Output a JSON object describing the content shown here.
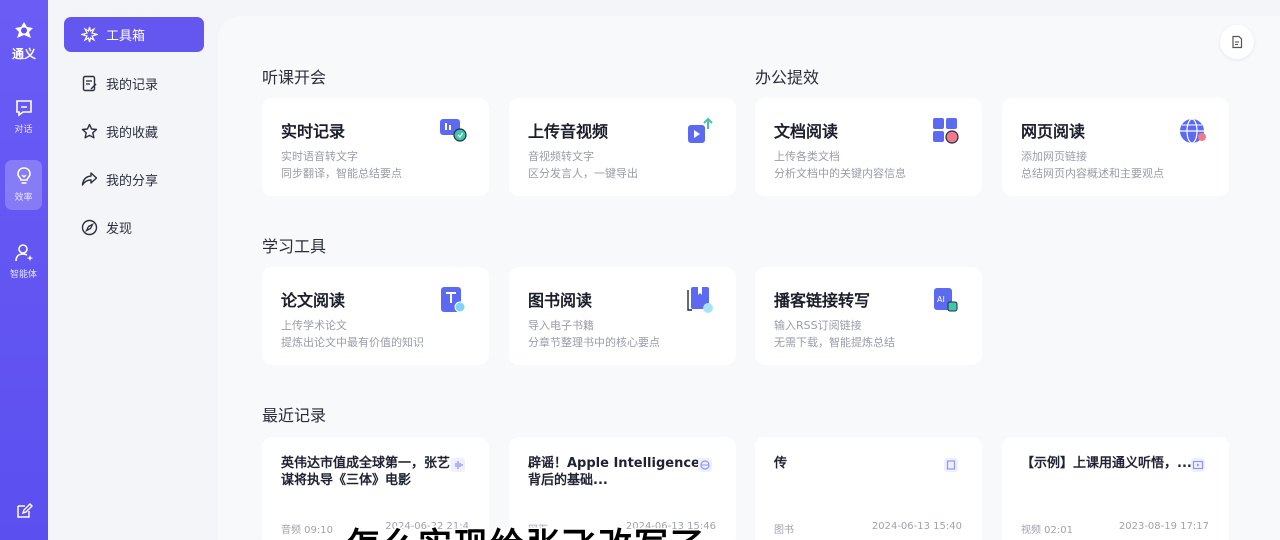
{
  "rail": {
    "logo_text": "通义",
    "items": [
      {
        "label": "对话",
        "icon": "chat-icon"
      },
      {
        "label": "效率",
        "icon": "lightbulb-icon",
        "active": true
      },
      {
        "label": "智能体",
        "icon": "agent-icon"
      }
    ],
    "bottom_icon": "edit-icon"
  },
  "subnav": {
    "items": [
      {
        "label": "工具箱",
        "icon": "toolbox-icon",
        "active": true
      },
      {
        "label": "我的记录",
        "icon": "record-icon"
      },
      {
        "label": "我的收藏",
        "icon": "star-icon"
      },
      {
        "label": "我的分享",
        "icon": "share-icon"
      },
      {
        "label": "发现",
        "icon": "compass-icon"
      }
    ]
  },
  "sections": {
    "listen": "听课开会",
    "office": "办公提效",
    "study": "学习工具",
    "recent": "最近记录"
  },
  "tools": [
    {
      "title": "实时记录",
      "desc1": "实时语音转文字",
      "desc2": "同步翻译，智能总结要点",
      "icon": "realtime-record-icon"
    },
    {
      "title": "上传音视频",
      "desc1": "音视频转文字",
      "desc2": "区分发言人，一键导出",
      "icon": "upload-media-icon"
    },
    {
      "title": "文档阅读",
      "desc1": "上传各类文档",
      "desc2": "分析文档中的关键内容信息",
      "icon": "document-read-icon"
    },
    {
      "title": "网页阅读",
      "desc1": "添加网页链接",
      "desc2": "总结网页内容概述和主要观点",
      "icon": "web-read-icon"
    },
    {
      "title": "论文阅读",
      "desc1": "上传学术论文",
      "desc2": "提炼出论文中最有价值的知识",
      "icon": "paper-read-icon"
    },
    {
      "title": "图书阅读",
      "desc1": "导入电子书籍",
      "desc2": "分章节整理书中的核心要点",
      "icon": "book-read-icon"
    },
    {
      "title": "播客链接转写",
      "desc1": "输入RSS订阅链接",
      "desc2": "无需下载，智能提炼总结",
      "icon": "podcast-icon"
    }
  ],
  "recent": [
    {
      "title": "英伟达市值成全球第一，张艺谋将执导《三体》电影",
      "meta": "音频 09:10",
      "date": "2024-06-22 21:4",
      "icon": "audio-wave-icon"
    },
    {
      "title": "辟谣！Apple Intelligence背后的基础...",
      "meta": "网页",
      "date": "2024-06-13 15:46",
      "icon": "globe-icon"
    },
    {
      "title": "传",
      "meta": "图书",
      "date": "2024-06-13 15:40",
      "icon": "image-icon"
    },
    {
      "title": "【示例】上课用通义听悟，...",
      "meta": "视频 02:01",
      "date": "2023-08-19 17:17",
      "icon": "video-icon"
    }
  ],
  "subtitle": "怎么实现给张飞改写了"
}
